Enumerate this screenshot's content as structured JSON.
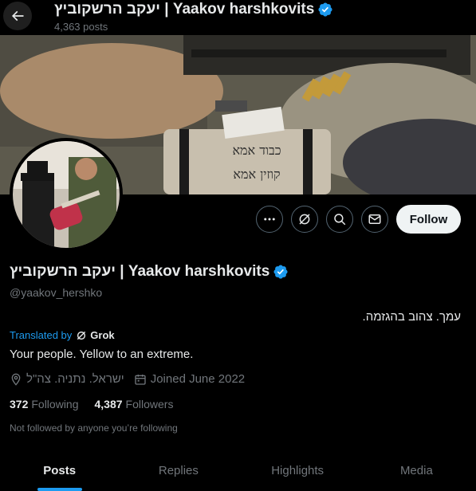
{
  "header": {
    "title": "יעקב הרשקוביץ | Yaakov harshkovits",
    "posts_count": "4,363 posts"
  },
  "banner": {
    "handwriting_line1": "כבוד אמא",
    "handwriting_line2": "קוזין אמא"
  },
  "actions": {
    "more_icon": "more-dots-icon",
    "grok_icon": "grok-icon",
    "search_icon": "search-icon",
    "message_icon": "envelope-icon",
    "follow_label": "Follow"
  },
  "profile": {
    "name": "יעקב הרשקוביץ | Yaakov harshkovits",
    "verified": true,
    "handle": "@yaakov_hershko",
    "bio_original": "עמך. צהוב בהגזמה.",
    "translated_by": "Translated by",
    "translator": "Grok",
    "bio_translated": "Your people. Yellow to an extreme.",
    "location": "ישראל. נתניה. צה\"ל",
    "joined": "Joined June 2022",
    "following_count": "372",
    "following_label": "Following",
    "followers_count": "4,387",
    "followers_label": "Followers",
    "not_followed": "Not followed by anyone you’re following"
  },
  "tabs": [
    {
      "label": "Posts",
      "active": true
    },
    {
      "label": "Replies",
      "active": false
    },
    {
      "label": "Highlights",
      "active": false
    },
    {
      "label": "Media",
      "active": false
    }
  ],
  "colors": {
    "accent": "#1d9bf0",
    "background": "#000000",
    "muted": "#71767b",
    "text": "#e7e9ea"
  }
}
